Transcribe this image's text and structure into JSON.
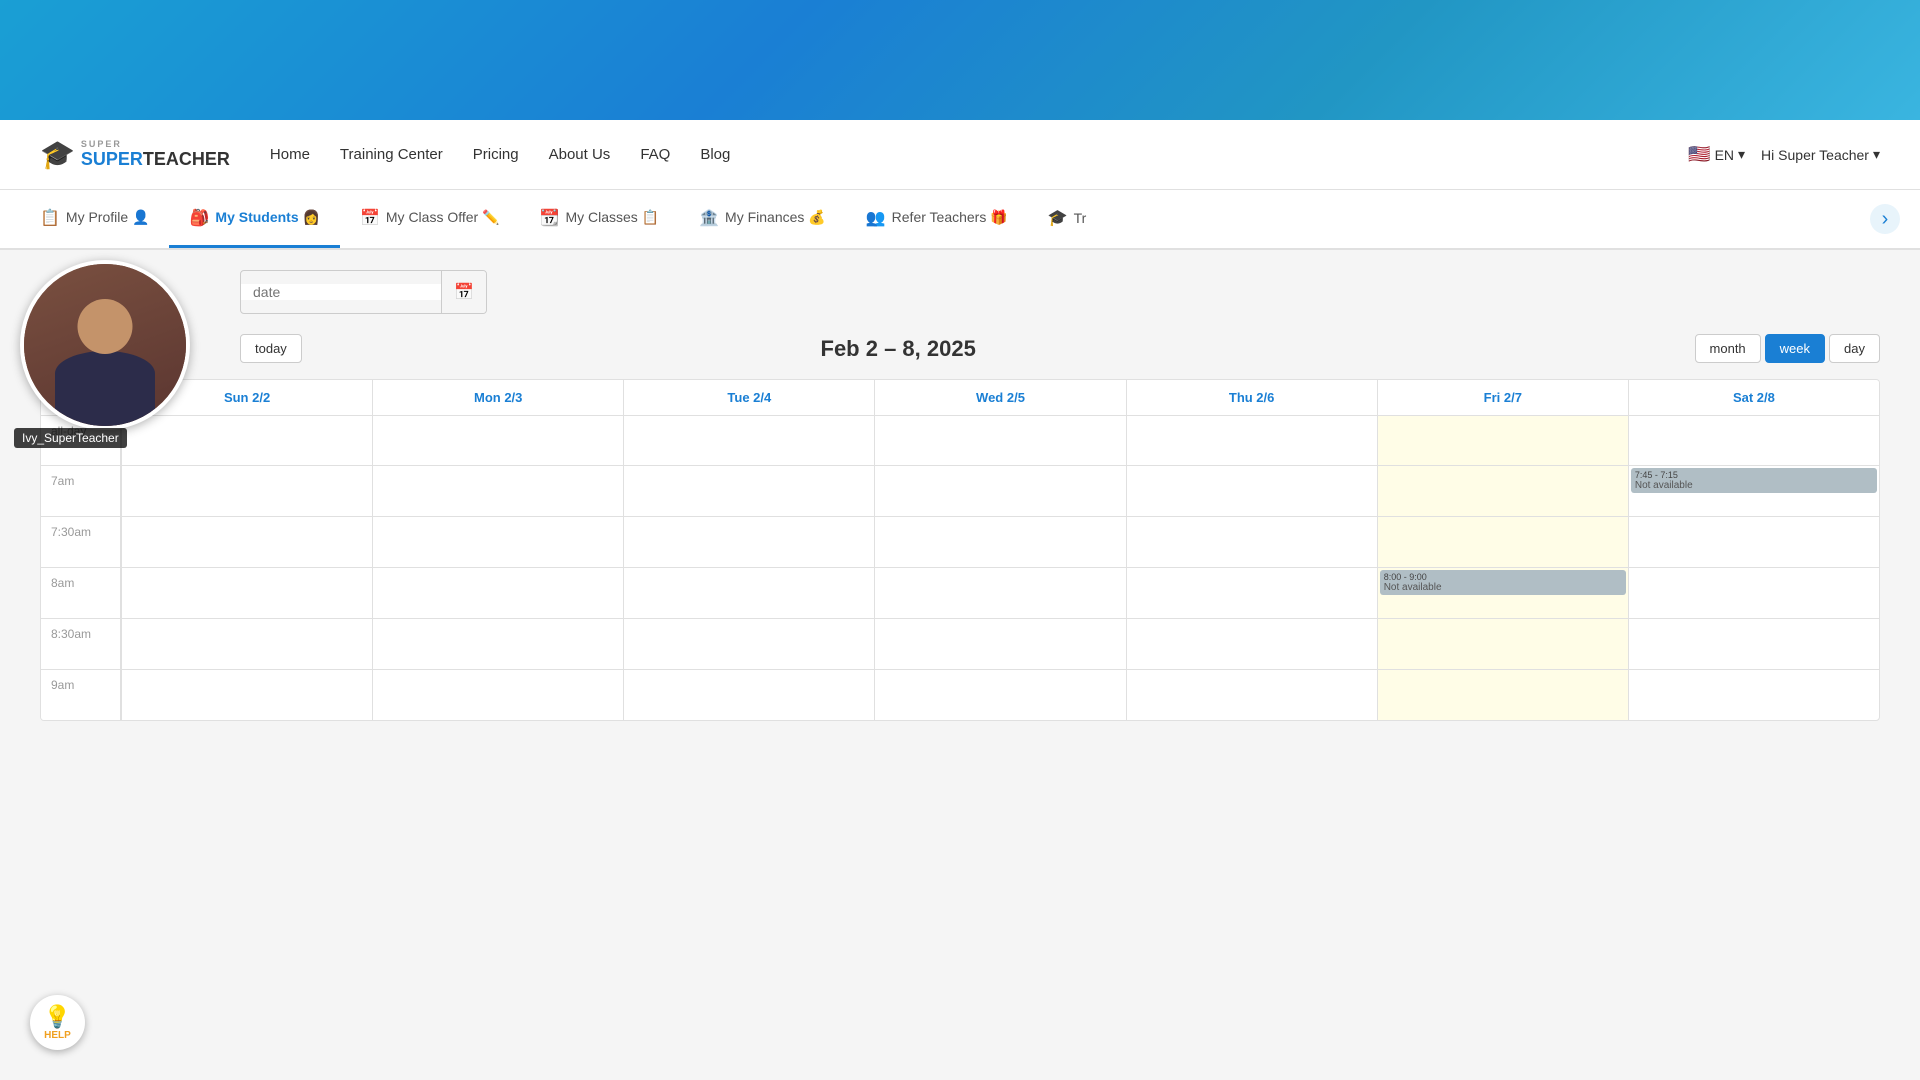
{
  "topBanner": {},
  "navbar": {
    "logo": "SUPERTEACHER",
    "logoTop": "SUPER",
    "logoBottom": "TEACHER",
    "links": [
      "Home",
      "Training Center",
      "Pricing",
      "About Us",
      "FAQ",
      "Blog"
    ],
    "language": "EN",
    "greeting": "Hi Super Teacher"
  },
  "subNav": {
    "items": [
      {
        "id": "my-profile",
        "label": "My Profile",
        "icon": "📋",
        "active": false
      },
      {
        "id": "my-students",
        "label": "My Students",
        "icon": "🎒",
        "active": true
      },
      {
        "id": "my-class-offer",
        "label": "My Class Offer",
        "icon": "📅",
        "active": false
      },
      {
        "id": "my-classes",
        "label": "My Classes",
        "icon": "📆",
        "active": false
      },
      {
        "id": "my-finances",
        "label": "My Finances",
        "icon": "💰",
        "active": false
      },
      {
        "id": "refer-teachers",
        "label": "Refer Teachers",
        "icon": "🎁",
        "active": false
      },
      {
        "id": "tr",
        "label": "Tr",
        "icon": "🎓",
        "active": false
      }
    ]
  },
  "videoWidget": {
    "username": "Ivy_SuperTeacher"
  },
  "dateControl": {
    "placeholder": "date"
  },
  "calendar": {
    "todayLabel": "today",
    "title": "Feb 2 – 8, 2025",
    "views": [
      "month",
      "week",
      "day"
    ],
    "activeView": "week",
    "days": [
      {
        "label": "Sun 2/2"
      },
      {
        "label": "Mon 2/3"
      },
      {
        "label": "Tue 2/4"
      },
      {
        "label": "Wed 2/5"
      },
      {
        "label": "Thu 2/6"
      },
      {
        "label": "Fri 2/7"
      },
      {
        "label": "Sat 2/8"
      }
    ],
    "timeSlots": [
      {
        "label": "all-day"
      },
      {
        "label": "7am"
      },
      {
        "label": "7:30am"
      },
      {
        "label": "8am"
      },
      {
        "label": "8:30am"
      },
      {
        "label": "9am"
      }
    ],
    "events": [
      {
        "id": "evt1",
        "day": 6,
        "slot": 1,
        "timeText": "7:45 - 7:15",
        "title": "Not available"
      },
      {
        "id": "evt2",
        "day": 5,
        "slot": 3,
        "timeText": "8:00 - 9:00",
        "title": "Not available"
      }
    ],
    "highlightedDays": [
      5,
      6
    ]
  },
  "help": {
    "label": "HELP"
  }
}
